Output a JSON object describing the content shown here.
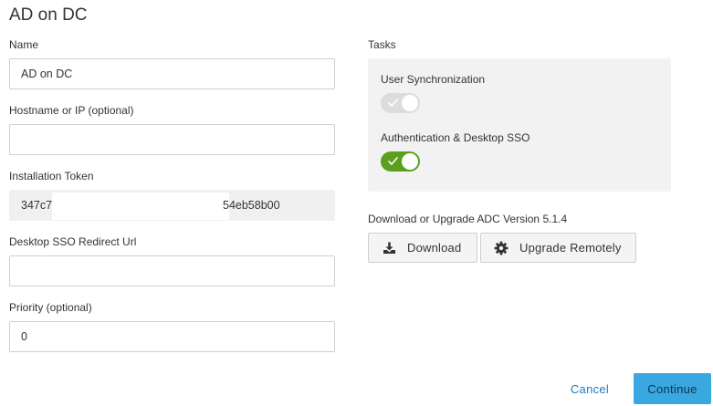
{
  "page": {
    "title": "AD on DC"
  },
  "form": {
    "name": {
      "label": "Name",
      "value": "AD on DC"
    },
    "hostname": {
      "label": "Hostname or IP (optional)",
      "value": ""
    },
    "token": {
      "label": "Installation Token",
      "value_start": "347c7",
      "value_end": "54eb58b00"
    },
    "sso_redirect": {
      "label": "Desktop SSO Redirect Url",
      "value": ""
    },
    "priority": {
      "label": "Priority (optional)",
      "value": "0"
    }
  },
  "tasks": {
    "label": "Tasks",
    "items": [
      {
        "label": "User Synchronization",
        "enabled": false,
        "disabled": true
      },
      {
        "label": "Authentication & Desktop SSO",
        "enabled": true,
        "disabled": false
      }
    ]
  },
  "download": {
    "title": "Download or Upgrade ADC Version 5.1.4",
    "download_label": "Download",
    "upgrade_label": "Upgrade Remotely",
    "download_icon": "download-icon",
    "upgrade_icon": "gear-icon"
  },
  "footer": {
    "cancel_label": "Cancel",
    "continue_label": "Continue"
  },
  "colors": {
    "toggle_on": "#5a9f1f",
    "primary": "#39a8e0",
    "link": "#1f7bc1"
  }
}
